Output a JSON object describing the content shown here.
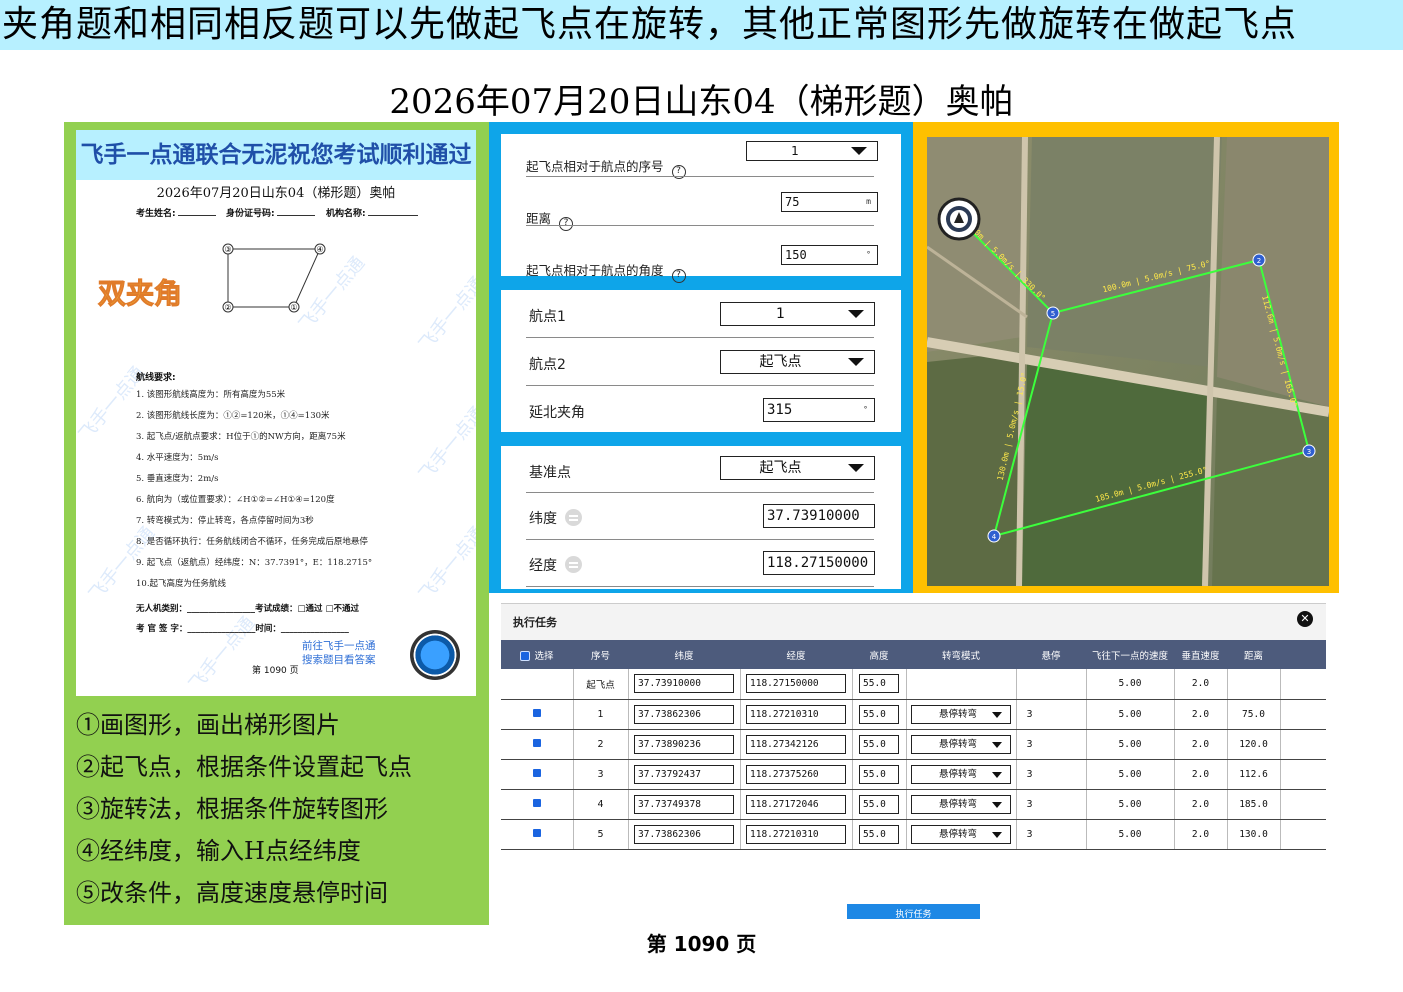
{
  "banner": "夹角题和相同相反题可以先做起飞点在旋转，其他正常图形先做旋转在做起飞点",
  "title": "2026年07月20日山东04（梯形题）奥帕",
  "exam_sheet": {
    "banner": "飞手一点通联合无泥祝您考试顺利通过",
    "title": "2026年07月20日山东04（梯形题）奥帕",
    "fields": [
      "考生姓名:",
      "身份证号码:",
      "机构名称:"
    ],
    "diagram_labels": [
      "①",
      "②",
      "③",
      "④"
    ],
    "badge": "双夹角",
    "requirements_title": "航线要求:",
    "requirements": [
      "1. 该图形航线高度为：所有高度为55米",
      "2. 该图形航线长度为：①②=120米，①④=130米",
      "3. 起飞点/返航点要求：H位于①的NW方向，距离75米",
      "4. 水平速度为：5m/s",
      "5. 垂直速度为：2m/s",
      "6. 航向为（或位置要求）：∠H①②=∠H①④=120度",
      "7. 转弯模式为：停止转弯，各点停留时间为3秒",
      "8. 是否循环执行：任务航线闭合不循环，任务完成后原地悬停",
      "9. 起飞点（返航点）经纬度：N：37.7391°，E：118.2715°",
      "10.起飞高度为任务航线"
    ],
    "sign_1": "无人机类别：________________考试成绩：□通过 □不通过",
    "sign_2": "考 官 签 字：________________时间：________________",
    "footer_page": "第 1090 页",
    "footer_link_1": "前往飞手一点通",
    "footer_link_2": "搜索题目看答案",
    "watermark": "飞手一点通"
  },
  "steps": [
    "①画图形，画出梯形图片",
    "②起飞点，根据条件设置起飞点",
    "③旋转法，根据条件旋转图形",
    "④经纬度，输入H点经纬度",
    "⑤改条件，高度速度悬停时间"
  ],
  "form1": {
    "seq_label": "起飞点相对于航点的序号",
    "seq_value": "1",
    "dist_label": "距离",
    "dist_value": "75",
    "dist_unit": "m",
    "angle_label": "起飞点相对于航点的角度",
    "angle_value": "150",
    "angle_unit": "°",
    "help": "?"
  },
  "form2": {
    "wp1_label": "航点1",
    "wp1_value": "1",
    "wp2_label": "航点2",
    "wp2_value": "起飞点",
    "north_label": "延北夹角",
    "north_value": "315",
    "north_unit": "°"
  },
  "form3": {
    "ref_label": "基准点",
    "ref_value": "起飞点",
    "lat_label": "纬度",
    "lat_value": "37.73910000",
    "lon_label": "经度",
    "lon_value": "118.27150000"
  },
  "map": {
    "waypoints": [
      "2",
      "5",
      "3",
      "4"
    ],
    "segments": [
      "100.0m | 5.0m/s | 75.0°",
      "112.6m | 5.0m/s | 165.0°",
      "185.0m | 5.0m/s | 255.0°",
      "130.0m | 5.0m/s | 15.0°",
      "75.0m | 5.0m/s | 330.0°"
    ],
    "home_icon": "home-marker-icon"
  },
  "task": {
    "title": "执行任务",
    "close": "✕",
    "headers": [
      "选择",
      "序号",
      "纬度",
      "经度",
      "高度",
      "转弯模式",
      "悬停",
      "飞往下一点的速度",
      "垂直速度",
      "距离"
    ],
    "rows": [
      {
        "seq": "起飞点",
        "lat": "37.73910000",
        "lon": "118.27150000",
        "alt": "55.0",
        "turn": "",
        "hover": "",
        "speed": "5.00",
        "vspeed": "2.0",
        "dist": "",
        "check": false
      },
      {
        "seq": "1",
        "lat": "37.73862306",
        "lon": "118.27210310",
        "alt": "55.0",
        "turn": "悬停转弯",
        "hover": "3",
        "speed": "5.00",
        "vspeed": "2.0",
        "dist": "75.0",
        "check": true
      },
      {
        "seq": "2",
        "lat": "37.73890236",
        "lon": "118.27342126",
        "alt": "55.0",
        "turn": "悬停转弯",
        "hover": "3",
        "speed": "5.00",
        "vspeed": "2.0",
        "dist": "120.0",
        "check": true
      },
      {
        "seq": "3",
        "lat": "37.73792437",
        "lon": "118.27375260",
        "alt": "55.0",
        "turn": "悬停转弯",
        "hover": "3",
        "speed": "5.00",
        "vspeed": "2.0",
        "dist": "112.6",
        "check": true
      },
      {
        "seq": "4",
        "lat": "37.73749378",
        "lon": "118.27172046",
        "alt": "55.0",
        "turn": "悬停转弯",
        "hover": "3",
        "speed": "5.00",
        "vspeed": "2.0",
        "dist": "185.0",
        "check": true
      },
      {
        "seq": "5",
        "lat": "37.73862306",
        "lon": "118.27210310",
        "alt": "55.0",
        "turn": "悬停转弯",
        "hover": "3",
        "speed": "5.00",
        "vspeed": "2.0",
        "dist": "130.0",
        "check": true
      }
    ],
    "execute_label": "执行任务"
  },
  "page_number": "第 1090 页",
  "colors": {
    "banner_bg": "#b7f0ff",
    "left_panel": "#92d050",
    "mid_panel": "#0ea5e9",
    "map_panel": "#ffc000",
    "route": "#3cff3c",
    "table_header": "#4d5b7c"
  }
}
